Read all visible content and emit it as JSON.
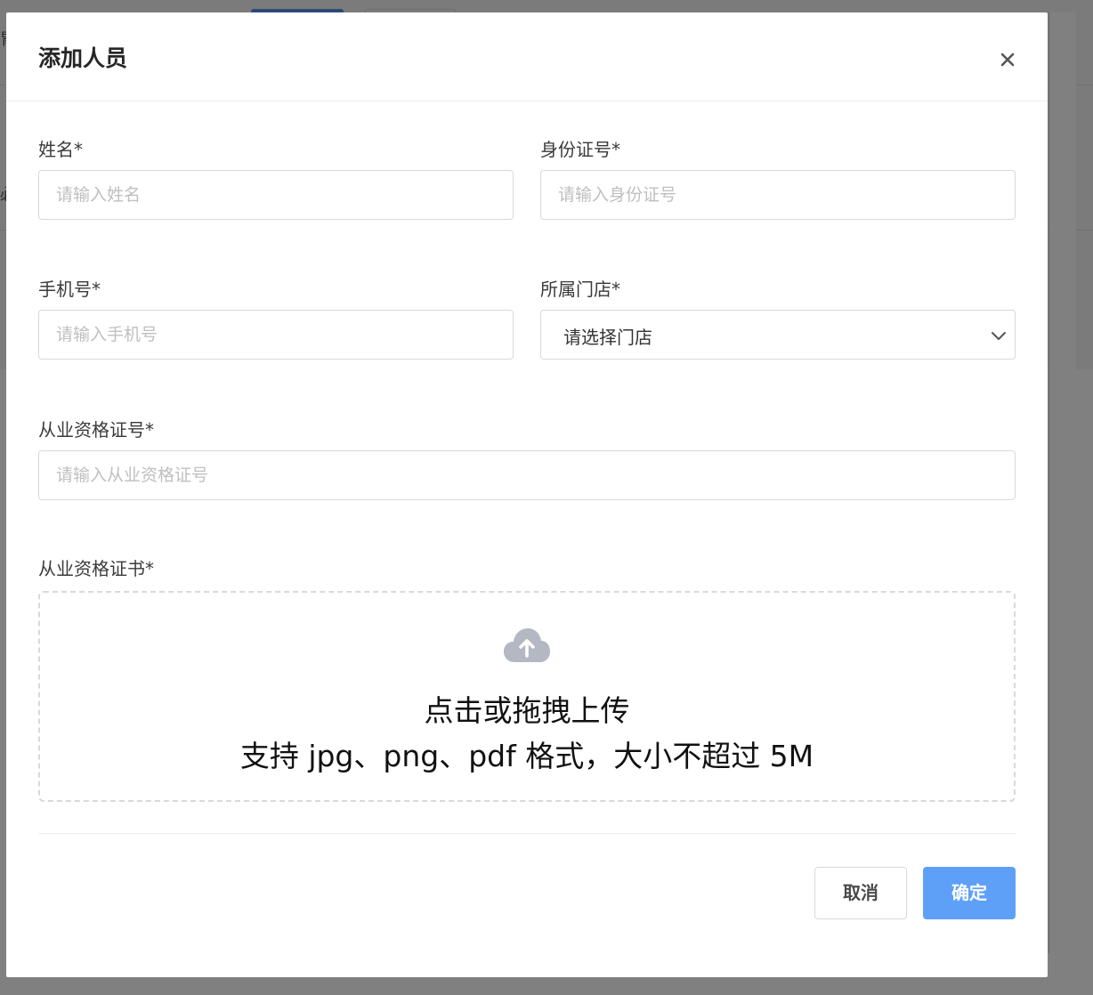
{
  "dialog": {
    "title": "添加人员",
    "close_label": "×"
  },
  "form": {
    "name": {
      "label": "姓名*",
      "placeholder": "请输入姓名",
      "value": ""
    },
    "id_number": {
      "label": "身份证号*",
      "placeholder": "请输入身份证号",
      "value": ""
    },
    "phone": {
      "label": "手机号*",
      "placeholder": "请输入手机号",
      "value": ""
    },
    "store": {
      "label": "所属门店*",
      "selected": "请选择门店"
    },
    "qualification_no": {
      "label": "从业资格证号*",
      "placeholder": "请输入从业资格证号",
      "value": ""
    },
    "qualification_cert": {
      "label": "从业资格证书*",
      "upload_line1": "点击或拖拽上传",
      "upload_line2": "支持 jpg、png、pdf 格式，大小不超过 5M"
    }
  },
  "footer": {
    "cancel_label": "取消",
    "confirm_label": "确定"
  },
  "colors": {
    "primary": "#5ea0f8",
    "border": "#d9d9d9",
    "placeholder": "#bfbfbf",
    "overlay": "#808080"
  },
  "icons": {
    "close": "close-icon",
    "chevron": "chevron-down-icon",
    "upload": "cloud-upload-icon"
  }
}
